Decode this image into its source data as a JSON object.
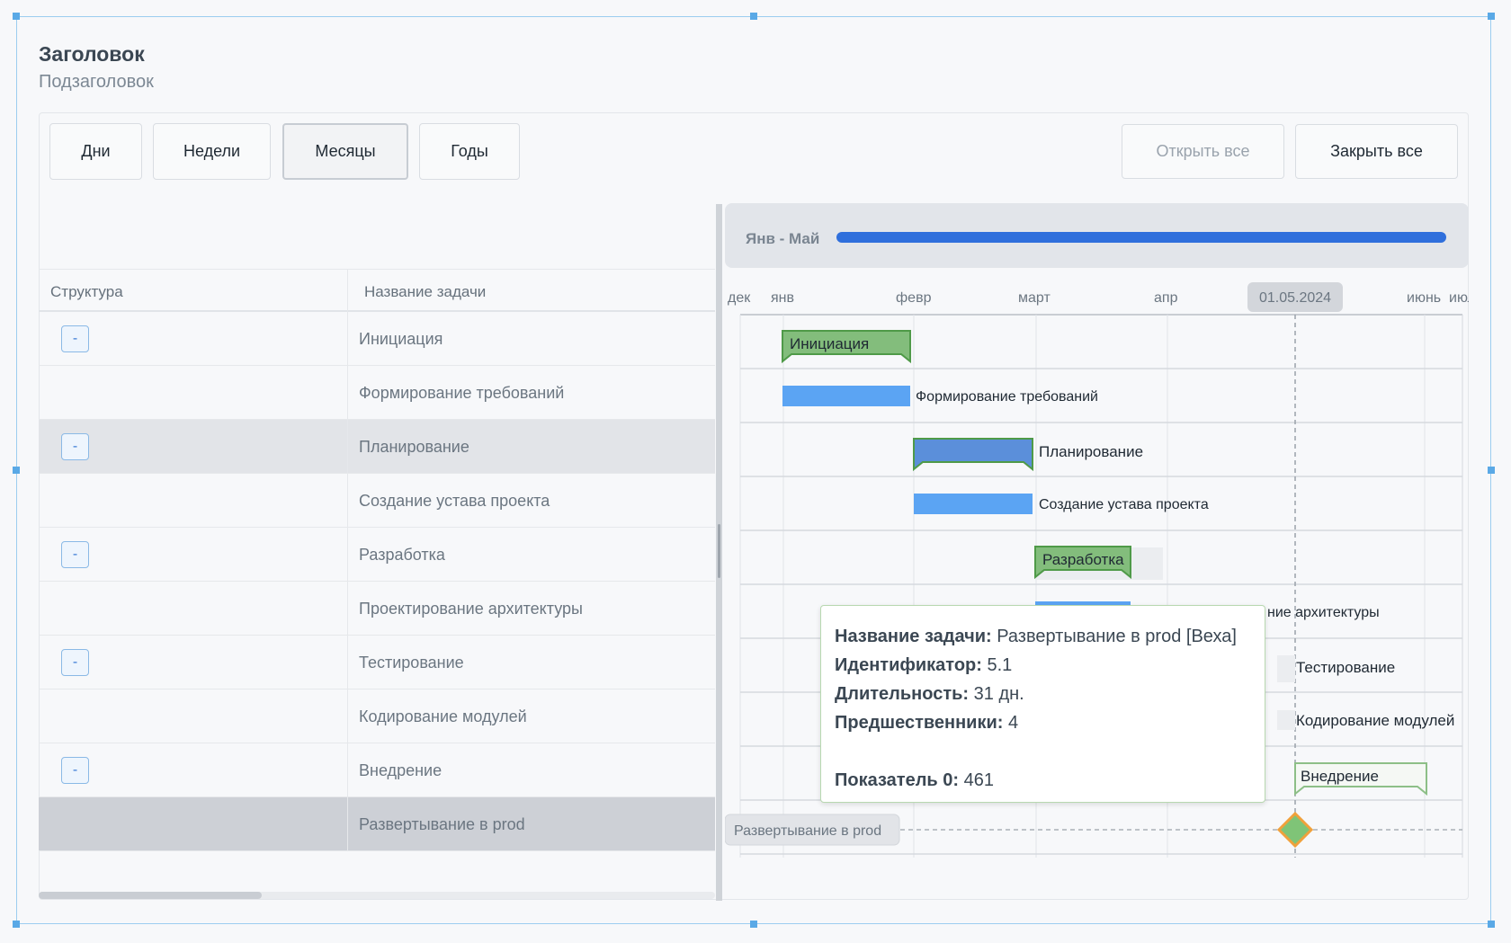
{
  "header": {
    "title": "Заголовок",
    "subtitle": "Подзаголовок"
  },
  "toolbar": {
    "scale_buttons": [
      "Дни",
      "Недели",
      "Месяцы",
      "Годы"
    ],
    "active_scale": "Месяцы",
    "expand_all": "Открыть все",
    "collapse_all": "Закрыть все"
  },
  "grid": {
    "columns": [
      "Структура",
      "Название задачи"
    ],
    "collapse_symbol": "-",
    "rows": [
      {
        "name": "Инициация",
        "group": true
      },
      {
        "name": "Формирование требований",
        "group": false
      },
      {
        "name": "Планирование",
        "group": true,
        "highlight": "hover"
      },
      {
        "name": "Создание устава проекта",
        "group": false
      },
      {
        "name": "Разработка",
        "group": true
      },
      {
        "name": "Проектирование архитектуры",
        "group": false
      },
      {
        "name": "Тестирование",
        "group": true
      },
      {
        "name": "Кодирование модулей",
        "group": false
      },
      {
        "name": "Внедрение",
        "group": true
      },
      {
        "name": "Развертывание в prod",
        "group": false,
        "highlight": "selected"
      }
    ]
  },
  "gantt": {
    "range_label": "Янв - Май",
    "months": [
      "дек",
      "янв",
      "февр",
      "март",
      "апр",
      "июнь",
      "июль"
    ],
    "today_label": "01.05.2024",
    "bar_labels": [
      "Инициация",
      "Формирование требований",
      "Планирование",
      "Создание устава проекта",
      "Разработка",
      "ние архитектуры",
      "Тестирование",
      "Кодирование модулей",
      "Внедрение",
      "Развертывание в prod"
    ],
    "colors": {
      "group": "#83bd7c",
      "group_border": "#4f9a48",
      "task": "#5ba4f3",
      "milestone": "#7fc477",
      "milestone_border": "#f0a13b",
      "progress": "#2f6fdc"
    }
  },
  "tooltip": {
    "rows": [
      {
        "label": "Название задачи:",
        "value": "Развертывание в prod [Веха]"
      },
      {
        "label": "Идентификатор:",
        "value": "5.1"
      },
      {
        "label": "Длительность:",
        "value": "31 дн."
      },
      {
        "label": "Предшественники:",
        "value": "4"
      },
      {
        "label": "",
        "value": ""
      },
      {
        "label": "Показатель 0:",
        "value": "461"
      }
    ]
  }
}
